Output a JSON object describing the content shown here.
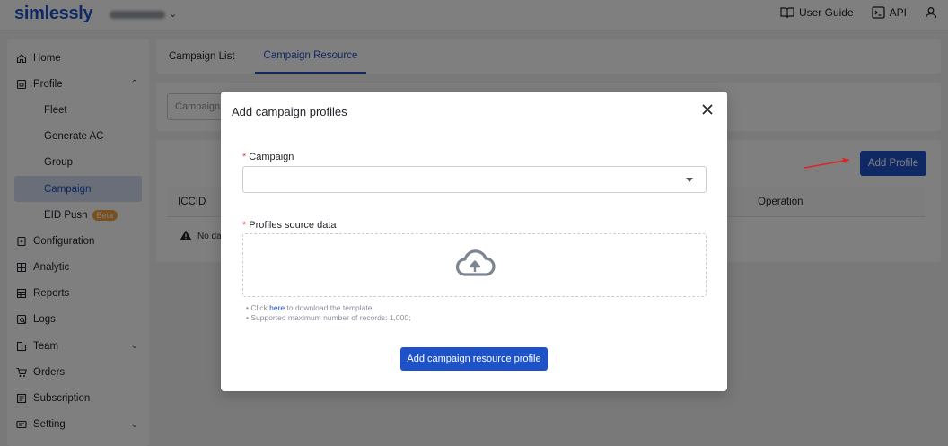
{
  "brand": {
    "logo_text": "simlessly"
  },
  "header": {
    "user_guide": "User Guide",
    "api": "API"
  },
  "sidebar": {
    "items": [
      {
        "label": "Home",
        "icon": "home-icon"
      },
      {
        "label": "Profile",
        "icon": "profile-icon",
        "expanded": true
      },
      {
        "label": "Fleet"
      },
      {
        "label": "Generate AC"
      },
      {
        "label": "Group"
      },
      {
        "label": "Campaign",
        "active": true
      },
      {
        "label": "EID Push",
        "badge": "Beta"
      },
      {
        "label": "Configuration",
        "icon": "configuration-icon"
      },
      {
        "label": "Analytic",
        "icon": "analytic-icon"
      },
      {
        "label": "Reports",
        "icon": "reports-icon"
      },
      {
        "label": "Logs",
        "icon": "logs-icon"
      },
      {
        "label": "Team",
        "icon": "team-icon",
        "expandable": true
      },
      {
        "label": "Orders",
        "icon": "cart-icon"
      },
      {
        "label": "Subscription",
        "icon": "subscription-icon"
      },
      {
        "label": "Setting",
        "icon": "setting-icon",
        "expandable": true
      }
    ]
  },
  "main": {
    "tabs": [
      {
        "label": "Campaign List"
      },
      {
        "label": "Campaign Resource",
        "active": true
      }
    ],
    "filter_placeholder": "Campaign",
    "add_profile_label": "Add Profile",
    "table": {
      "columns": [
        "ICCID",
        "Operation"
      ],
      "no_data": "No da"
    }
  },
  "modal": {
    "title": "Add campaign profiles",
    "campaign_label": "Campaign",
    "profiles_label": "Profiles source data",
    "hint_prefix": "Click ",
    "hint_link": "here",
    "hint_suffix": " to download the template;",
    "hint_max": "Supported maximum number of records: 1,000;",
    "submit_label": "Add campaign resource profile",
    "required_mark": "*"
  },
  "colors": {
    "accent": "#1d52c9",
    "required": "#e5484d",
    "badge": "#f4a13a",
    "annotation": "#e02424"
  }
}
